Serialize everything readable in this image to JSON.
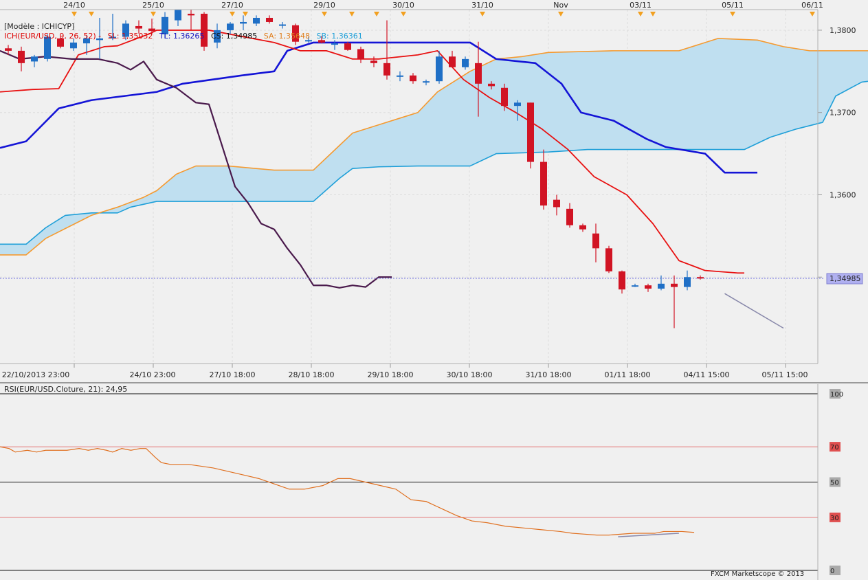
{
  "chart_data": [
    {
      "type": "candlestick",
      "title": "[Modèle : ICHICYP]",
      "indicator_legend": {
        "ich": "ICH(EUR/USD, 9, 26, 52) -",
        "sl": "SL: 1,35032",
        "tl": "TL: 1,36265",
        "cs": "CS: 1,34985",
        "sa": "SA: 1,35648",
        "sb": "SB: 1,36361"
      },
      "last_price_label": "1,34985",
      "last_price": 1.34985,
      "ylim": [
        1.3395,
        1.3825
      ],
      "yticks": [
        "1,3800",
        "1,3700",
        "1,3600",
        "1,3500"
      ],
      "ytick_values": [
        1.38,
        1.37,
        1.36,
        1.35
      ],
      "top_dates": [
        "24/10",
        "25/10",
        "27/10",
        "29/10",
        "30/10",
        "31/10",
        "Nov",
        "03/11",
        "05/11",
        "06/11"
      ],
      "bottom_dates": [
        "22/10/2013 23:00",
        "24/10 23:00",
        "27/10 18:00",
        "28/10 18:00",
        "29/10 18:00",
        "30/10 18:00",
        "31/10 18:00",
        "01/11 18:00",
        "04/11 15:00",
        "05/11 15:00"
      ],
      "bar_count": 63,
      "candles": [
        [
          1.3778,
          1.3782,
          1.377,
          1.3775
        ],
        [
          1.3775,
          1.378,
          1.375,
          1.376
        ],
        [
          1.3762,
          1.377,
          1.3755,
          1.3768
        ],
        [
          1.3765,
          1.3795,
          1.3762,
          1.3792
        ],
        [
          1.379,
          1.3793,
          1.3778,
          1.378
        ],
        [
          1.3778,
          1.379,
          1.3775,
          1.3785
        ],
        [
          1.3784,
          1.3793,
          1.377,
          1.379
        ],
        [
          1.3788,
          1.3815,
          1.3765,
          1.379
        ],
        [
          1.379,
          1.382,
          1.3788,
          1.3792
        ],
        [
          1.3792,
          1.3812,
          1.3788,
          1.3808
        ],
        [
          1.3805,
          1.3812,
          1.3796,
          1.3802
        ],
        [
          1.3802,
          1.3814,
          1.3795,
          1.3799
        ],
        [
          1.3795,
          1.3822,
          1.379,
          1.3816
        ],
        [
          1.3812,
          1.3825,
          1.3805,
          1.3825
        ],
        [
          1.382,
          1.3825,
          1.38,
          1.3818
        ],
        [
          1.382,
          1.3822,
          1.3775,
          1.378
        ],
        [
          1.3785,
          1.3808,
          1.3778,
          1.38
        ],
        [
          1.38,
          1.381,
          1.3795,
          1.3808
        ],
        [
          1.3808,
          1.3818,
          1.38,
          1.381
        ],
        [
          1.3808,
          1.3818,
          1.3805,
          1.3815
        ],
        [
          1.3815,
          1.3818,
          1.3808,
          1.381
        ],
        [
          1.3807,
          1.381,
          1.3802,
          1.3807
        ],
        [
          1.3806,
          1.3808,
          1.3782,
          1.3786
        ],
        [
          1.3788,
          1.3792,
          1.3785,
          1.3788
        ],
        [
          1.3788,
          1.3793,
          1.3784,
          1.3785
        ],
        [
          1.3784,
          1.3788,
          1.3776,
          1.3784
        ],
        [
          1.3784,
          1.3786,
          1.3775,
          1.3776
        ],
        [
          1.3777,
          1.378,
          1.376,
          1.3765
        ],
        [
          1.3763,
          1.3768,
          1.3755,
          1.376
        ],
        [
          1.376,
          1.3812,
          1.374,
          1.3745
        ],
        [
          1.3745,
          1.375,
          1.3738,
          1.3745
        ],
        [
          1.3745,
          1.3748,
          1.3735,
          1.3738
        ],
        [
          1.3738,
          1.374,
          1.3733,
          1.3738
        ],
        [
          1.3738,
          1.3775,
          1.3735,
          1.3768
        ],
        [
          1.3768,
          1.3775,
          1.3755,
          1.3755
        ],
        [
          1.3755,
          1.3768,
          1.3752,
          1.3765
        ],
        [
          1.376,
          1.3786,
          1.3695,
          1.3735
        ],
        [
          1.3735,
          1.3738,
          1.3728,
          1.3732
        ],
        [
          1.373,
          1.3735,
          1.3702,
          1.3708
        ],
        [
          1.3708,
          1.3715,
          1.369,
          1.3712
        ],
        [
          1.3712,
          1.3712,
          1.3632,
          1.364
        ],
        [
          1.364,
          1.3655,
          1.3582,
          1.3587
        ],
        [
          1.3594,
          1.36,
          1.3575,
          1.3585
        ],
        [
          1.3583,
          1.359,
          1.356,
          1.3563
        ],
        [
          1.3563,
          1.3565,
          1.3555,
          1.3558
        ],
        [
          1.3553,
          1.3565,
          1.3518,
          1.3535
        ],
        [
          1.3535,
          1.3538,
          1.3505,
          1.3507
        ],
        [
          1.3507,
          1.3508,
          1.348,
          1.3485
        ],
        [
          1.349,
          1.3492,
          1.3488,
          1.349
        ],
        [
          1.349,
          1.3492,
          1.3482,
          1.3486
        ],
        [
          1.3486,
          1.3502,
          1.3484,
          1.3492
        ],
        [
          1.3492,
          1.3502,
          1.3438,
          1.3488
        ],
        [
          1.3488,
          1.3508,
          1.3484,
          1.35
        ],
        [
          1.35,
          1.3502,
          1.3497,
          1.3499
        ]
      ],
      "tenkan": [
        [
          0,
          1.3725
        ],
        [
          5,
          1.3728
        ],
        [
          9,
          1.3729
        ],
        [
          12,
          1.377
        ],
        [
          16,
          1.378
        ],
        [
          18,
          1.3781
        ],
        [
          23,
          1.3796
        ],
        [
          24,
          1.38
        ],
        [
          27,
          1.38
        ],
        [
          32,
          1.38
        ],
        [
          42,
          1.3785
        ],
        [
          46,
          1.3775
        ],
        [
          50,
          1.3775
        ],
        [
          54,
          1.3765
        ],
        [
          58,
          1.3765
        ],
        [
          64,
          1.377
        ],
        [
          67,
          1.3775
        ],
        [
          71,
          1.374
        ],
        [
          75,
          1.3718
        ],
        [
          79,
          1.37
        ],
        [
          83,
          1.368
        ],
        [
          87,
          1.3655
        ],
        [
          91,
          1.3622
        ],
        [
          96,
          1.36
        ],
        [
          100,
          1.3565
        ],
        [
          104,
          1.352
        ],
        [
          108,
          1.3508
        ],
        [
          113,
          1.3505
        ],
        [
          114,
          1.3505
        ]
      ],
      "kijun": [
        [
          0,
          1.3657
        ],
        [
          4,
          1.3665
        ],
        [
          9,
          1.3705
        ],
        [
          14,
          1.3715
        ],
        [
          24,
          1.3725
        ],
        [
          28,
          1.3735
        ],
        [
          37,
          1.3745
        ],
        [
          42,
          1.375
        ],
        [
          44,
          1.3775
        ],
        [
          48,
          1.3785
        ],
        [
          60,
          1.3785
        ],
        [
          64,
          1.3785
        ],
        [
          72,
          1.3785
        ],
        [
          76,
          1.3765
        ],
        [
          82,
          1.376
        ],
        [
          86,
          1.3735
        ],
        [
          89,
          1.37
        ],
        [
          94,
          1.369
        ],
        [
          99,
          1.3668
        ],
        [
          102,
          1.3658
        ],
        [
          108,
          1.365
        ],
        [
          111,
          1.3627
        ],
        [
          116,
          1.3627
        ]
      ],
      "span_a": [
        [
          0,
          1.3527
        ],
        [
          4,
          1.3527
        ],
        [
          7,
          1.3547
        ],
        [
          14,
          1.3575
        ],
        [
          18,
          1.3585
        ],
        [
          22,
          1.3597
        ],
        [
          24,
          1.3605
        ],
        [
          27,
          1.3625
        ],
        [
          30,
          1.3635
        ],
        [
          35,
          1.3635
        ],
        [
          42,
          1.363
        ],
        [
          48,
          1.363
        ],
        [
          52,
          1.366
        ],
        [
          54,
          1.3675
        ],
        [
          58,
          1.3685
        ],
        [
          62,
          1.3695
        ],
        [
          64,
          1.37
        ],
        [
          67,
          1.3725
        ],
        [
          70,
          1.374
        ],
        [
          72,
          1.375
        ],
        [
          76,
          1.3765
        ],
        [
          80,
          1.3768
        ],
        [
          84,
          1.3773
        ],
        [
          94,
          1.3775
        ],
        [
          104,
          1.3775
        ],
        [
          110,
          1.379
        ],
        [
          116,
          1.3788
        ],
        [
          120,
          1.378
        ],
        [
          124,
          1.3775
        ],
        [
          130,
          1.3775
        ],
        [
          140,
          1.3775
        ],
        [
          144,
          1.376
        ],
        [
          148,
          1.376
        ]
      ],
      "span_b": [
        [
          0,
          1.354
        ],
        [
          4,
          1.354
        ],
        [
          7,
          1.356
        ],
        [
          10,
          1.3575
        ],
        [
          14,
          1.3578
        ],
        [
          18,
          1.3578
        ],
        [
          20,
          1.3585
        ],
        [
          24,
          1.3592
        ],
        [
          32,
          1.3592
        ],
        [
          48,
          1.3592
        ],
        [
          52,
          1.362
        ],
        [
          54,
          1.3632
        ],
        [
          58,
          1.3634
        ],
        [
          64,
          1.3635
        ],
        [
          72,
          1.3635
        ],
        [
          76,
          1.365
        ],
        [
          84,
          1.3652
        ],
        [
          90,
          1.3655
        ],
        [
          100,
          1.3655
        ],
        [
          110,
          1.3655
        ],
        [
          114,
          1.3655
        ],
        [
          118,
          1.367
        ],
        [
          122,
          1.368
        ],
        [
          126,
          1.3688
        ],
        [
          128,
          1.372
        ],
        [
          132,
          1.3737
        ],
        [
          136,
          1.3741
        ],
        [
          148,
          1.3741
        ]
      ],
      "chikou": [
        [
          0,
          1.3775
        ],
        [
          3,
          1.3765
        ],
        [
          7,
          1.3768
        ],
        [
          11,
          1.3765
        ],
        [
          15,
          1.3765
        ],
        [
          18,
          1.376
        ],
        [
          20,
          1.3752
        ],
        [
          22,
          1.3762
        ],
        [
          24,
          1.374
        ],
        [
          27,
          1.373
        ],
        [
          30,
          1.3712
        ],
        [
          32,
          1.371
        ],
        [
          34,
          1.366
        ],
        [
          36,
          1.361
        ],
        [
          38,
          1.359
        ],
        [
          40,
          1.3565
        ],
        [
          42,
          1.3558
        ],
        [
          44,
          1.3535
        ],
        [
          46,
          1.3515
        ],
        [
          48,
          1.349
        ],
        [
          50,
          1.349
        ],
        [
          52,
          1.3487
        ],
        [
          54,
          1.349
        ],
        [
          56,
          1.3488
        ],
        [
          58,
          1.35
        ],
        [
          60,
          1.35
        ]
      ],
      "trendline": [
        [
          111,
          1.348
        ],
        [
          120,
          1.3438
        ]
      ],
      "rsi": {
        "title": "RSI(EUR/USD.Cloture, 21): 24,95",
        "ylim": [
          0,
          100
        ],
        "levels": [
          "100",
          "70",
          "50",
          "30",
          "0"
        ],
        "level_values": [
          100,
          70,
          50,
          30,
          0
        ],
        "values": [
          [
            0,
            70
          ],
          [
            3,
            69
          ],
          [
            5,
            67
          ],
          [
            9,
            68
          ],
          [
            12,
            67
          ],
          [
            15,
            68
          ],
          [
            22,
            68
          ],
          [
            26,
            69
          ],
          [
            29,
            68
          ],
          [
            32,
            69
          ],
          [
            35,
            68
          ],
          [
            37,
            67
          ],
          [
            40,
            69
          ],
          [
            43,
            68
          ],
          [
            46,
            69
          ],
          [
            48,
            69
          ],
          [
            51,
            64
          ],
          [
            53,
            61
          ],
          [
            56,
            60
          ],
          [
            62,
            60
          ],
          [
            70,
            58
          ],
          [
            75,
            56
          ],
          [
            80,
            54
          ],
          [
            85,
            52
          ],
          [
            90,
            49
          ],
          [
            95,
            46
          ],
          [
            100,
            46
          ],
          [
            106,
            48
          ],
          [
            111,
            52
          ],
          [
            115,
            52
          ],
          [
            120,
            50
          ],
          [
            125,
            48
          ],
          [
            130,
            46
          ],
          [
            135,
            40
          ],
          [
            140,
            39
          ],
          [
            145,
            35
          ],
          [
            150,
            31
          ],
          [
            155,
            28
          ],
          [
            160,
            27
          ],
          [
            166,
            25
          ],
          [
            172,
            24
          ],
          [
            178,
            23
          ],
          [
            184,
            22
          ],
          [
            188,
            21
          ],
          [
            192,
            20.5
          ],
          [
            196,
            20
          ],
          [
            200,
            20
          ],
          [
            208,
            21
          ],
          [
            215,
            21
          ],
          [
            218,
            22
          ],
          [
            221,
            22
          ],
          [
            224,
            22
          ],
          [
            228,
            21.5
          ]
        ],
        "trendline": [
          [
            203,
            19
          ],
          [
            223,
            21
          ]
        ]
      },
      "rsi_grid_label_colors": {
        "neutral": "#aaaaaa",
        "level": "#e05050"
      },
      "watermark": "FXCM Marketscope © 2013",
      "colors": {
        "background": "#f0f0f0",
        "bull": "#1f6fc6",
        "bear": "#d11424",
        "tenkan": "#e81010",
        "kijun": "#1414d6",
        "span_a": "#f59a30",
        "span_b": "#1e9fd8",
        "cloud": "#bfdff0",
        "chikou": "#4a1a4c",
        "rsi_line": "#e07020",
        "rsi_level": "#e05050",
        "price_tag": "#b0b0f0"
      }
    }
  ]
}
